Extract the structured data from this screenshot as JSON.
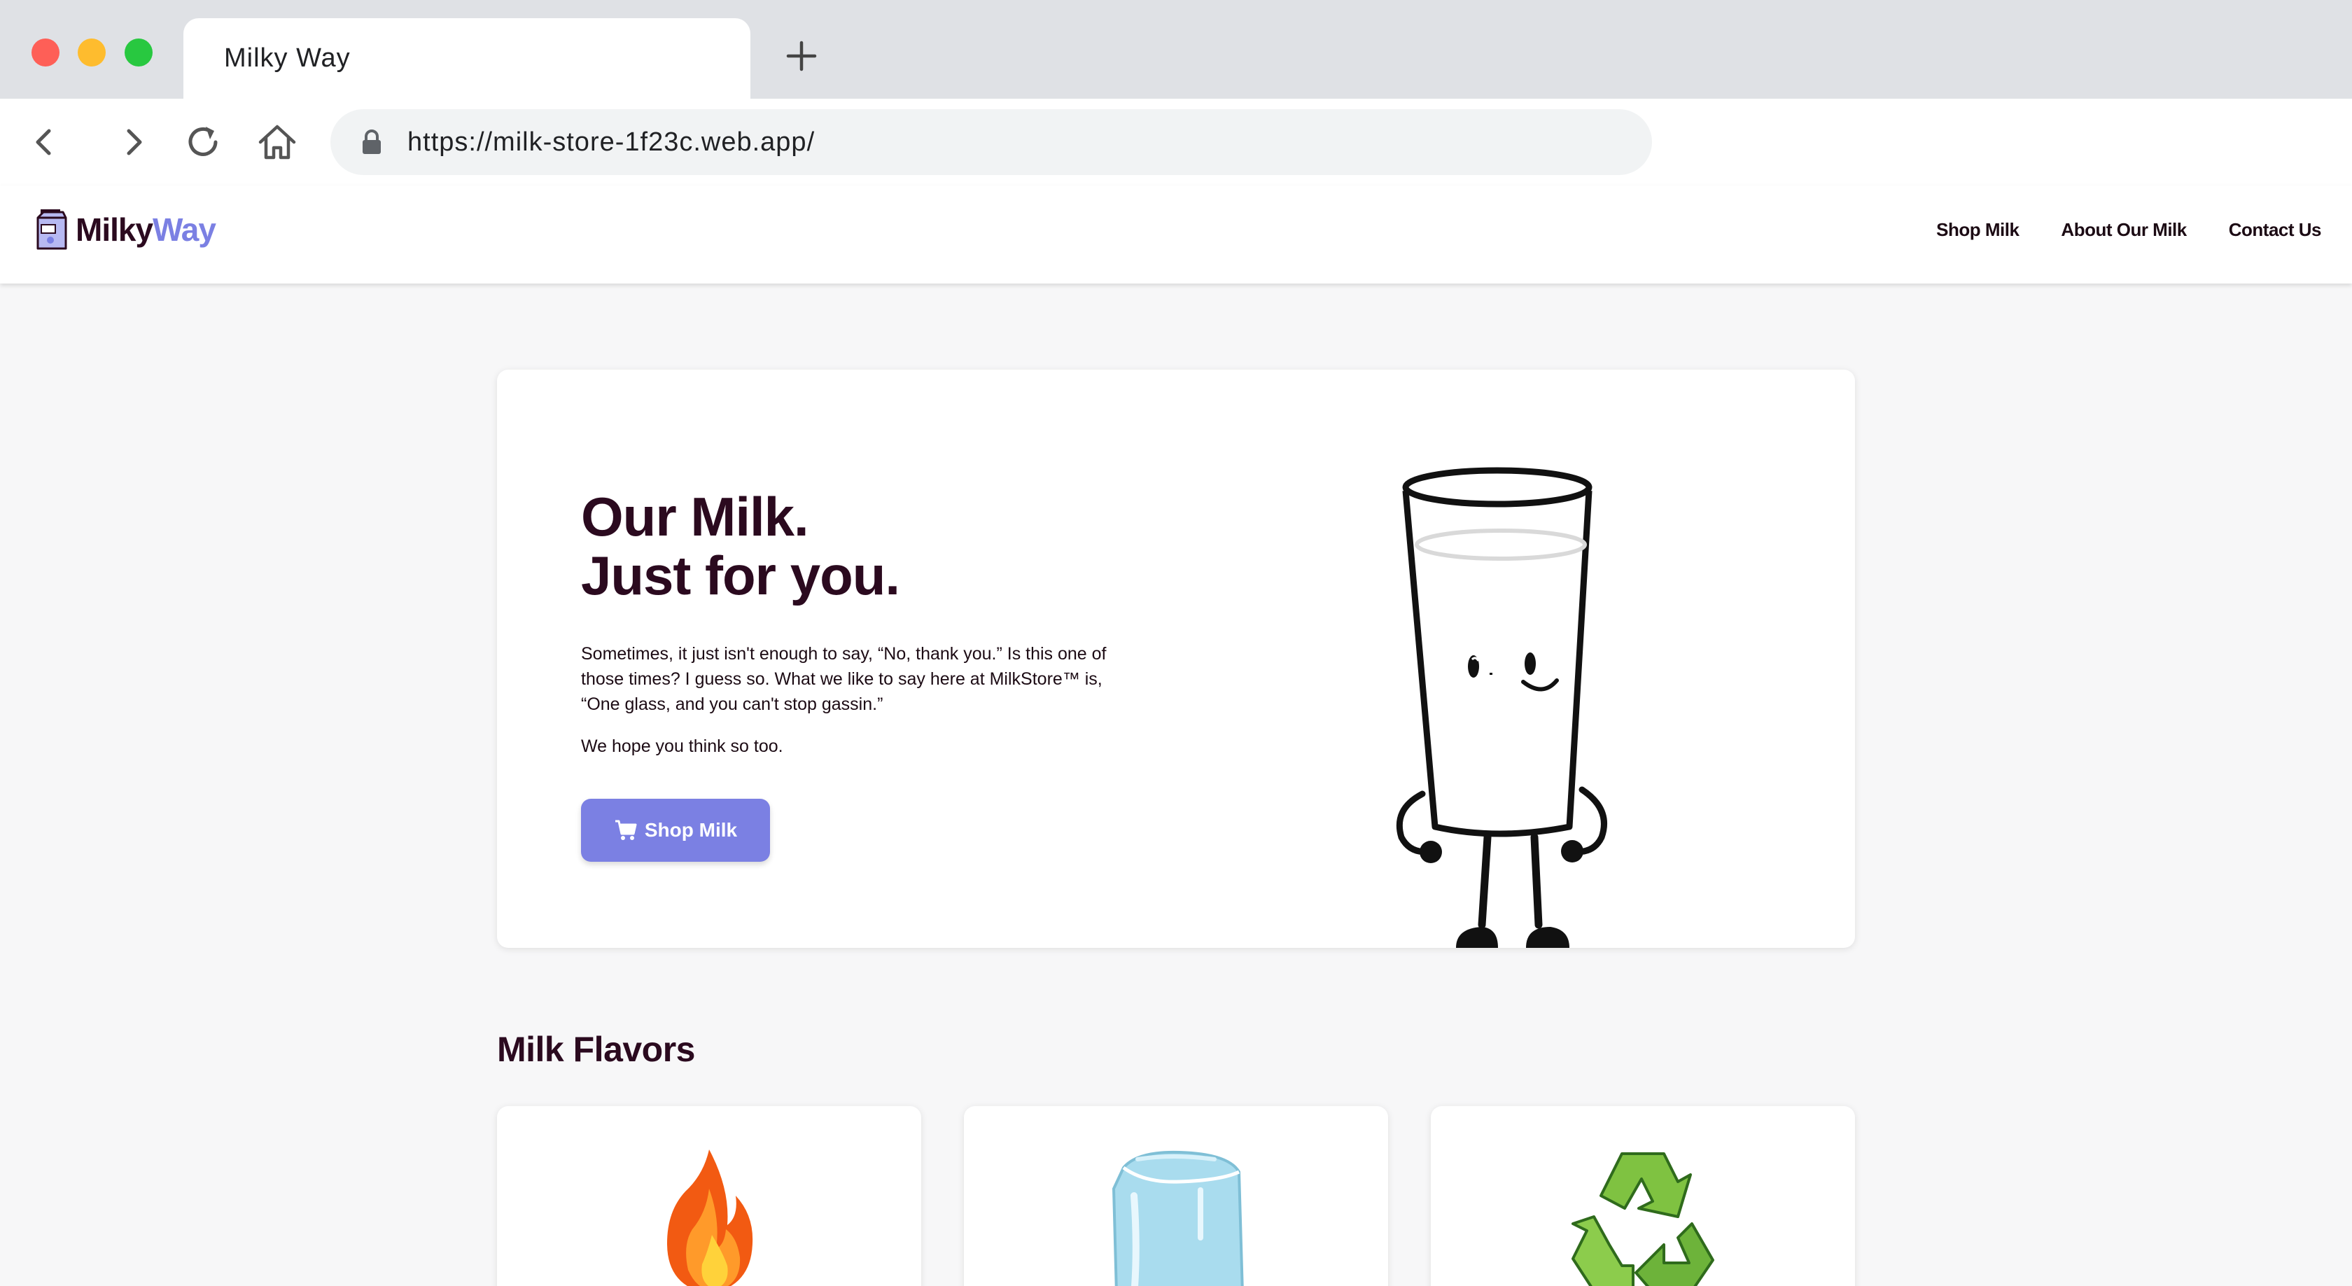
{
  "browser": {
    "tab_title": "Milky Way",
    "url": "https://milk-store-1f23c.web.app/"
  },
  "site": {
    "logo_part1": "Milky",
    "logo_part2": "Way",
    "nav": [
      "Shop Milk",
      "About Our Milk",
      "Contact Us"
    ]
  },
  "hero": {
    "title_line1": "Our Milk.",
    "title_line2": "Just for you.",
    "paragraph1": "Sometimes, it just isn't enough to say, “No, thank you.” Is this one of those times? I guess so. What we like to say here at MilkStore™ is, “One glass, and you can't stop gassin.”",
    "paragraph2": "We hope you think so too.",
    "button_label": "Shop Milk"
  },
  "flavors": {
    "heading": "Milk Flavors",
    "icons": [
      "fire-icon",
      "ice-cube-icon",
      "recycle-icon"
    ]
  },
  "colors": {
    "brand_dark": "#2b0a1f",
    "brand_accent": "#7b80e3",
    "page_bg": "#f7f7f8"
  }
}
